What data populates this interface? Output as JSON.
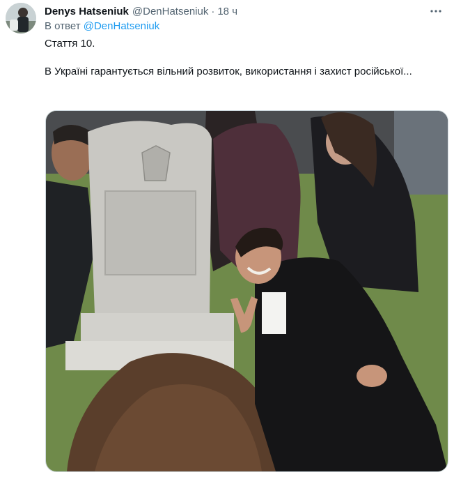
{
  "tweet": {
    "author_name": "Denys Hatseniuk",
    "author_handle": "@DenHatseniuk",
    "separator": "·",
    "time": "18 ч",
    "reply_prefix": "В ответ",
    "reply_mention": "@DenHatseniuk",
    "text_line1": "Стаття 10.",
    "text_line2": "В Україні гарантується вільний розвиток, використання і захист російської..."
  },
  "icons": {
    "more": "more-horizontal-icon",
    "avatar": "avatar-image"
  },
  "colors": {
    "name": "#0f1419",
    "secondary": "#536471",
    "link": "#1d9bf0",
    "border": "#cfd9de"
  }
}
